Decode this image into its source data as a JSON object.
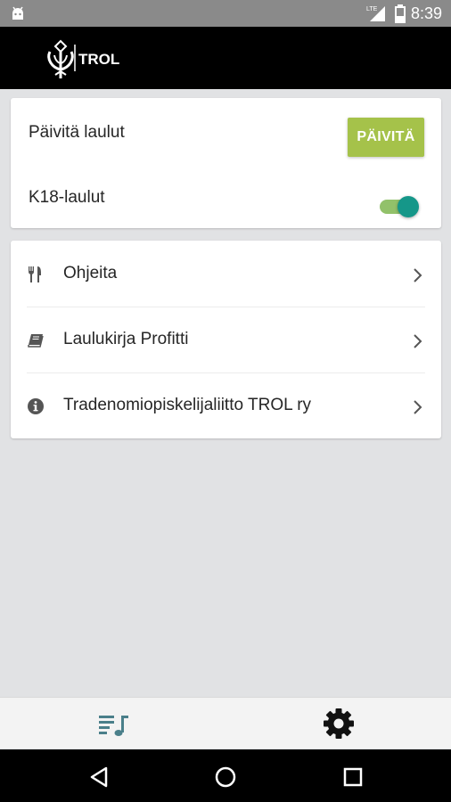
{
  "status_bar": {
    "time": "8:39",
    "network_label": "LTE",
    "icons": [
      "android-icon",
      "lte-signal-icon",
      "battery-icon"
    ]
  },
  "app_bar": {
    "logo_text": "TROL"
  },
  "settings_card": {
    "update_label": "Päivitä laulut",
    "update_button": "PÄIVITÄ",
    "adult_songs_label": "K18-laulut",
    "adult_songs_enabled": true
  },
  "links": [
    {
      "label": "Ohjeita",
      "icon": "cutlery-icon"
    },
    {
      "label": "Laulukirja Profitti",
      "icon": "book-icon"
    },
    {
      "label": "Tradenomiopiskelijaliitto TROL ry",
      "icon": "info-icon"
    }
  ],
  "bottom_nav": {
    "items": [
      {
        "icon": "playlist-music-icon"
      },
      {
        "icon": "gear-icon"
      }
    ]
  },
  "colors": {
    "accent_green": "#a5c24a",
    "toggle_thumb": "#159789",
    "toggle_track": "#92c16a",
    "background": "#e1e2e4",
    "app_bar": "#000000"
  }
}
